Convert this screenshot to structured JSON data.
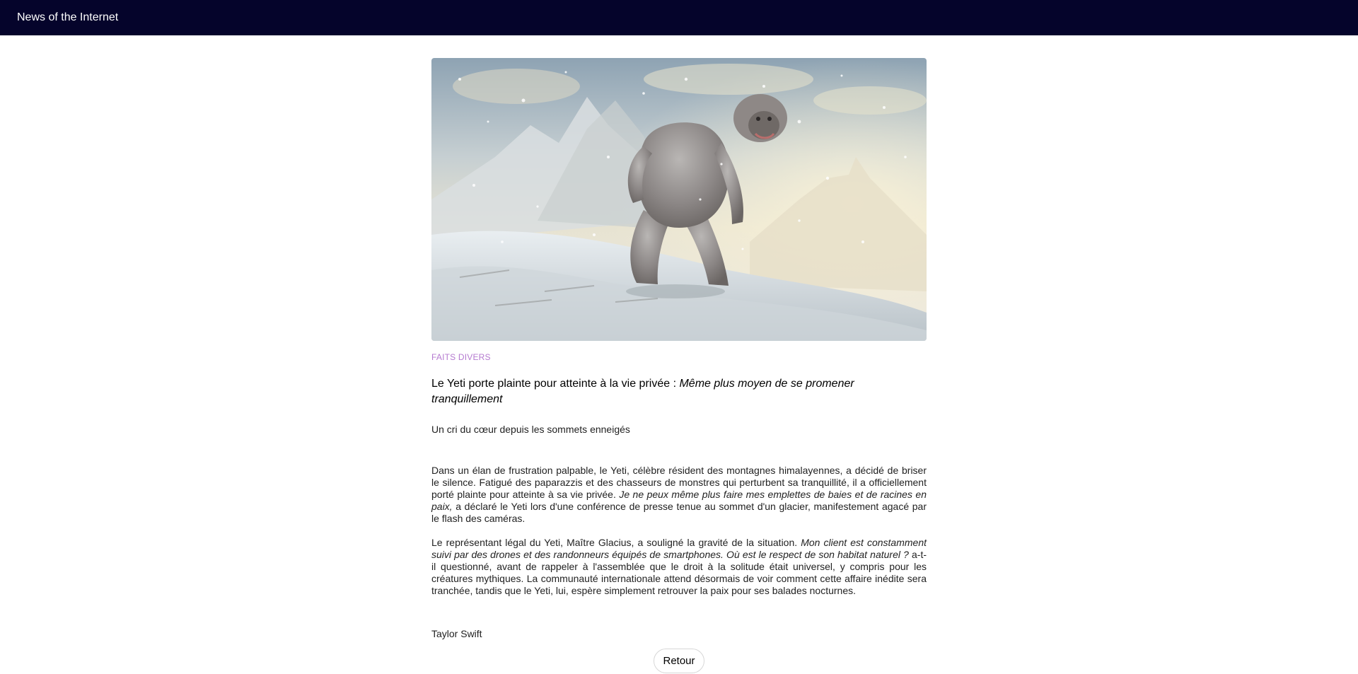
{
  "header": {
    "site_title": "News of the Internet"
  },
  "article": {
    "category": "FAITS DIVERS",
    "headline_main": "Le Yeti porte plainte pour atteinte à la vie privée : ",
    "headline_quote": "Même plus moyen de se promener tranquillement",
    "subtitle": "Un cri du cœur depuis les sommets enneigés",
    "p1_a": "Dans un élan de frustration palpable, le Yeti, célèbre résident des montagnes himalayennes, a décidé de briser le silence. Fatigué des paparazzis et des chasseurs de monstres qui perturbent sa tranquillité, il a officiellement porté plainte pour atteinte à sa vie privée. ",
    "p1_quote": "Je ne peux même plus faire mes emplettes de baies et de racines en paix,",
    "p1_b": " a déclaré le Yeti lors d'une conférence de presse tenue au sommet d'un glacier, manifestement agacé par le flash des caméras.",
    "p2_a": "Le représentant légal du Yeti, Maître Glacius, a souligné la gravité de la situation. ",
    "p2_quote": "Mon client est constamment suivi par des drones et des randonneurs équipés de smartphones. Où est le respect de son habitat naturel ?",
    "p2_b": " a-t-il questionné, avant de rappeler à l'assemblée que le droit à la solitude était universel, y compris pour les créatures mythiques. La communauté internationale attend désormais de voir comment cette affaire inédite sera tranchée, tandis que le Yeti, lui, espère simplement retrouver la paix pour ses balades nocturnes.",
    "author": "Taylor Swift"
  },
  "actions": {
    "back_label": "Retour"
  },
  "colors": {
    "topbar": "#05042b",
    "category": "#b57ad0"
  }
}
